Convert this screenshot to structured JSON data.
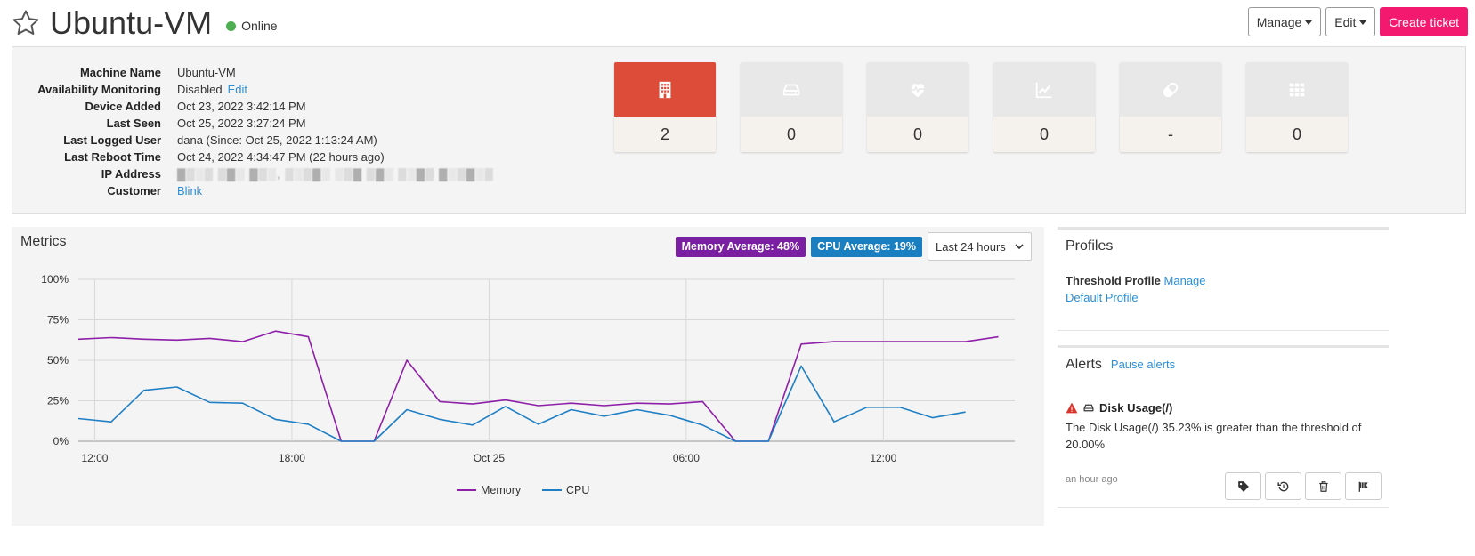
{
  "header": {
    "title": "Ubuntu-VM",
    "status": "Online",
    "status_color": "#4caf50"
  },
  "actions": {
    "manage_label": "Manage",
    "edit_label": "Edit",
    "create_ticket_label": "Create ticket"
  },
  "info": {
    "rows": [
      {
        "label": "Machine Name",
        "value": "Ubuntu-VM"
      },
      {
        "label": "Availability Monitoring",
        "value": "Disabled",
        "link": "Edit"
      },
      {
        "label": "Device Added",
        "value": "Oct 23, 2022 3:42:14 PM"
      },
      {
        "label": "Last Seen",
        "value": "Oct 25, 2022 3:27:24 PM"
      },
      {
        "label": "Last Logged User",
        "value": "dana (Since: Oct 25, 2022 1:13:24 AM)"
      },
      {
        "label": "Last Reboot Time",
        "value": "Oct 24, 2022 4:34:47 PM (22 hours ago)"
      },
      {
        "label": "IP Address",
        "value": "▓▒░▒ ▒▓░ ▓▒░, ▒░▒▓░ ░▒▓ ▒▓░ ▒░▓▒ ▓░▒▓░▒"
      },
      {
        "label": "Customer",
        "link": "Blink"
      }
    ]
  },
  "tiles": [
    {
      "icon": "building-icon",
      "value": "2",
      "active": true
    },
    {
      "icon": "hard-drive-icon",
      "value": "0"
    },
    {
      "icon": "heartbeat-icon",
      "value": "0"
    },
    {
      "icon": "line-chart-icon",
      "value": "0"
    },
    {
      "icon": "pill-icon",
      "value": "-"
    },
    {
      "icon": "grid-icon",
      "value": "0"
    }
  ],
  "metrics": {
    "title": "Metrics",
    "memory_badge": "Memory Average: 48%",
    "cpu_badge": "CPU Average: 19%",
    "range": "Last 24 hours",
    "memory_color": "#8e1fa8",
    "cpu_color": "#1f7fc4"
  },
  "chart_data": {
    "type": "line",
    "ylim": [
      0,
      100
    ],
    "yticks": [
      "0%",
      "25%",
      "50%",
      "75%",
      "100%"
    ],
    "xticks": [
      "12:00",
      "18:00",
      "Oct 25",
      "06:00",
      "12:00"
    ],
    "x_hours": [
      11.5,
      12.5,
      13.5,
      14.5,
      15.5,
      16.5,
      17.5,
      18.5,
      19.5,
      20.5,
      21.5,
      22.5,
      23.5,
      24.5,
      25.5,
      26.5,
      27.5,
      28.5,
      29.5,
      30.5,
      31.5,
      32.5,
      33.5,
      34.5,
      35.5,
      36.5,
      37.5,
      38.5,
      39.5
    ],
    "series": [
      {
        "name": "Memory",
        "values": [
          63,
          64,
          63,
          62.5,
          63.5,
          61.5,
          68,
          64.5,
          0,
          0,
          50,
          24.5,
          23,
          25.5,
          22,
          23.5,
          22,
          23.5,
          23,
          24.5,
          0,
          0,
          60,
          61.5,
          61.5,
          61.5,
          61.5,
          61.5,
          64.5
        ]
      },
      {
        "name": "CPU",
        "values": [
          14,
          12,
          31.5,
          33.5,
          24,
          23.5,
          13.5,
          10.5,
          0,
          0,
          19.5,
          13.5,
          10,
          21.5,
          10.5,
          19.5,
          15.5,
          19.5,
          16,
          10,
          0,
          0,
          46.5,
          12,
          21,
          21,
          14.5,
          18
        ]
      }
    ],
    "legend": [
      "Memory",
      "CPU"
    ]
  },
  "profiles": {
    "title": "Profiles",
    "threshold_label": "Threshold Profile",
    "manage_link": "Manage",
    "default_profile": "Default Profile"
  },
  "alerts": {
    "title": "Alerts",
    "pause_link": "Pause alerts",
    "alert_title": "Disk Usage(/)",
    "alert_text": "The Disk Usage(/) 35.23% is greater than the threshold of 20.00%",
    "time": "an hour ago",
    "action_icons": [
      "tag-icon",
      "history-icon",
      "trash-icon",
      "flag-icon"
    ]
  }
}
